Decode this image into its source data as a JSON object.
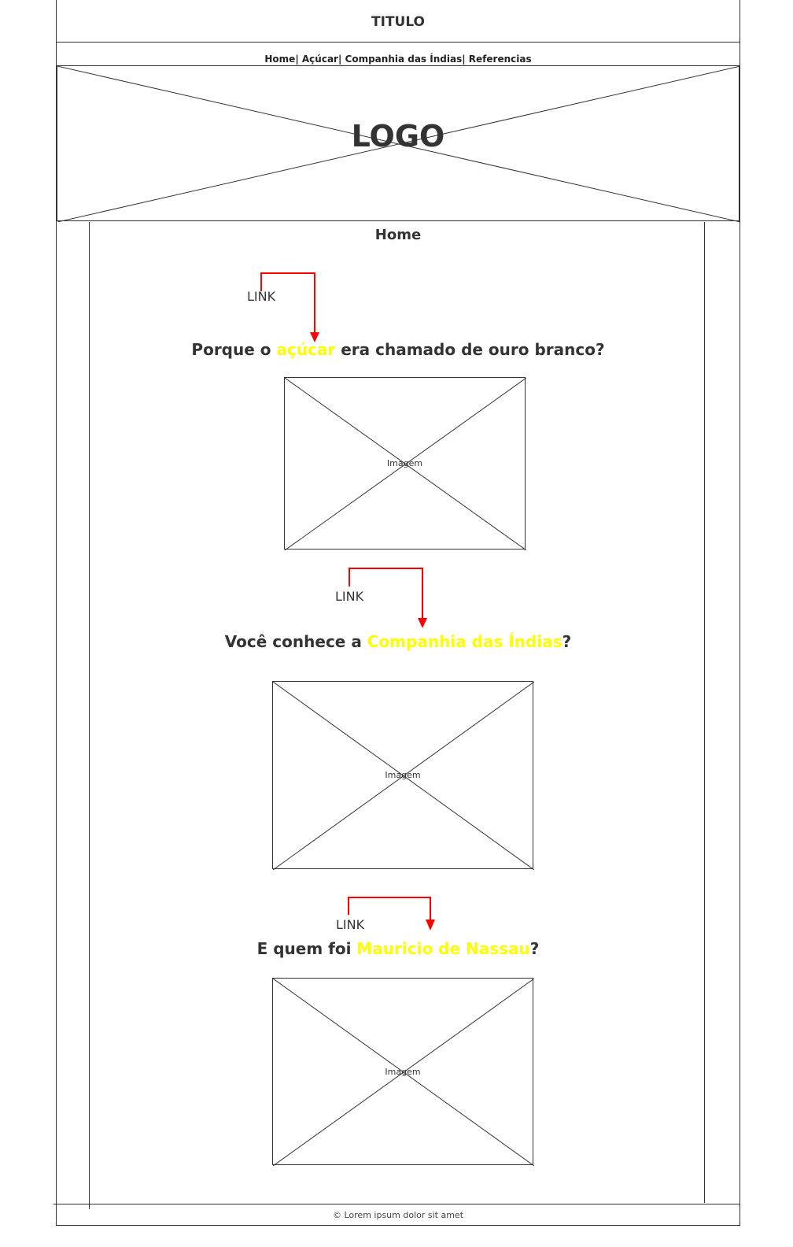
{
  "header": {
    "title": "TITULO"
  },
  "nav": {
    "items": [
      "Home",
      "Açúcar",
      "Companhia das Índias",
      "Referencias"
    ],
    "separator": "| "
  },
  "logo": {
    "text": "LOGO"
  },
  "main": {
    "heading": "Home",
    "sections": [
      {
        "link_label": "LINK",
        "question_before": "Porque o ",
        "question_highlight": "açúcar",
        "question_after": " era chamado de ouro branco?",
        "image_label": "Imagem"
      },
      {
        "link_label": "LINK",
        "question_before": "Você conhece a ",
        "question_highlight": "Companhia das Índias",
        "question_after": "?",
        "image_label": "Imagem"
      },
      {
        "link_label": "LINK",
        "question_before": "E quem foi ",
        "question_highlight": "Mauricio de Nassau",
        "question_after": "?",
        "image_label": "Imagem"
      }
    ]
  },
  "footer": {
    "text": "© Lorem ipsum dolor sit amet"
  },
  "colors": {
    "highlight": "#ffff00",
    "arrow": "#ff0000",
    "line": "#333333"
  }
}
